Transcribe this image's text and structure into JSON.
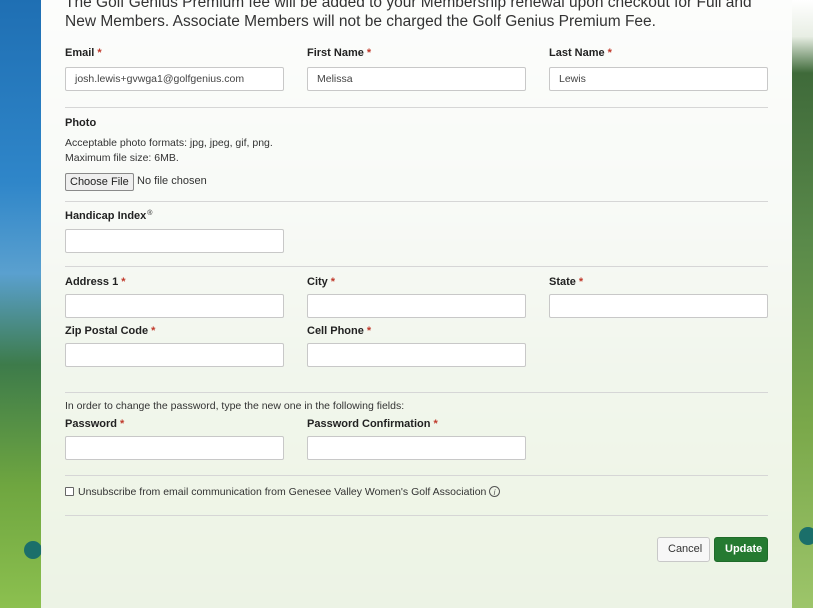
{
  "intro_text": "The Golf Genius Premium fee will be added to your Membership renewal upon checkout for Full and New Members. Associate Members will not be charged the Golf Genius Premium Fee.",
  "fields": {
    "email": {
      "label": "Email",
      "required": "*",
      "value": "josh.lewis+gvwga1@golfgenius.com"
    },
    "first_name": {
      "label": "First Name",
      "required": "*",
      "value": "Melissa"
    },
    "last_name": {
      "label": "Last Name",
      "required": "*",
      "value": "Lewis"
    },
    "handicap": {
      "label": "Handicap Index",
      "mark": "®",
      "value": ""
    },
    "address1": {
      "label": "Address 1",
      "required": "*",
      "value": ""
    },
    "city": {
      "label": "City",
      "required": "*",
      "value": ""
    },
    "state": {
      "label": "State",
      "required": "*",
      "value": ""
    },
    "zip": {
      "label": "Zip Postal Code",
      "required": "*",
      "value": ""
    },
    "cell_phone": {
      "label": "Cell Phone",
      "required": "*",
      "value": ""
    },
    "password": {
      "label": "Password",
      "required": "*",
      "value": ""
    },
    "password_confirmation": {
      "label": "Password Confirmation",
      "required": "*",
      "value": ""
    }
  },
  "photo": {
    "label": "Photo",
    "formats": "Acceptable photo formats: jpg, jpeg, gif, png.",
    "max_size": "Maximum file size: 6MB.",
    "choose_button": "Choose File",
    "no_file": "No file chosen"
  },
  "password_note": "In order to change the password, type the new one in the following fields:",
  "unsubscribe": {
    "label": "Unsubscribe from email communication from Genesee Valley Women's Golf Association",
    "info_glyph": "i"
  },
  "actions": {
    "cancel": "Cancel",
    "update": "Update"
  },
  "colors": {
    "accent": "#257a31",
    "required": "#c0392b"
  }
}
